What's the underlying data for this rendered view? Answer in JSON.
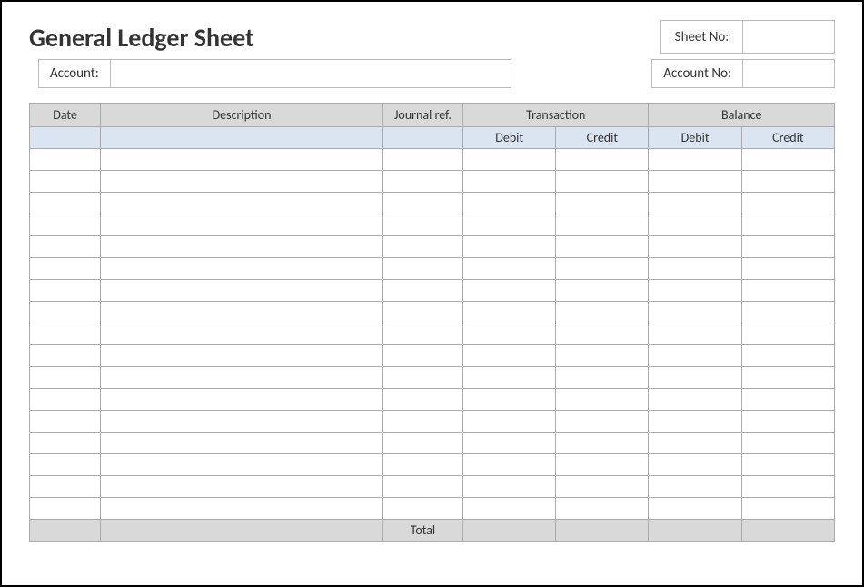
{
  "header": {
    "title": "General Ledger Sheet",
    "sheet_no_label": "Sheet No:",
    "sheet_no_value": "",
    "account_label": "Account:",
    "account_value": "",
    "account_no_label": "Account No:",
    "account_no_value": ""
  },
  "table": {
    "headers": {
      "date": "Date",
      "description": "Description",
      "journal_ref": "Journal ref.",
      "transaction": "Transaction",
      "balance": "Balance"
    },
    "subheaders": {
      "tx_debit": "Debit",
      "tx_credit": "Credit",
      "bal_debit": "Debit",
      "bal_credit": "Credit"
    },
    "rows": [
      {
        "date": "",
        "description": "",
        "journal_ref": "",
        "tx_debit": "",
        "tx_credit": "",
        "bal_debit": "",
        "bal_credit": ""
      },
      {
        "date": "",
        "description": "",
        "journal_ref": "",
        "tx_debit": "",
        "tx_credit": "",
        "bal_debit": "",
        "bal_credit": ""
      },
      {
        "date": "",
        "description": "",
        "journal_ref": "",
        "tx_debit": "",
        "tx_credit": "",
        "bal_debit": "",
        "bal_credit": ""
      },
      {
        "date": "",
        "description": "",
        "journal_ref": "",
        "tx_debit": "",
        "tx_credit": "",
        "bal_debit": "",
        "bal_credit": ""
      },
      {
        "date": "",
        "description": "",
        "journal_ref": "",
        "tx_debit": "",
        "tx_credit": "",
        "bal_debit": "",
        "bal_credit": ""
      },
      {
        "date": "",
        "description": "",
        "journal_ref": "",
        "tx_debit": "",
        "tx_credit": "",
        "bal_debit": "",
        "bal_credit": ""
      },
      {
        "date": "",
        "description": "",
        "journal_ref": "",
        "tx_debit": "",
        "tx_credit": "",
        "bal_debit": "",
        "bal_credit": ""
      },
      {
        "date": "",
        "description": "",
        "journal_ref": "",
        "tx_debit": "",
        "tx_credit": "",
        "bal_debit": "",
        "bal_credit": ""
      },
      {
        "date": "",
        "description": "",
        "journal_ref": "",
        "tx_debit": "",
        "tx_credit": "",
        "bal_debit": "",
        "bal_credit": ""
      },
      {
        "date": "",
        "description": "",
        "journal_ref": "",
        "tx_debit": "",
        "tx_credit": "",
        "bal_debit": "",
        "bal_credit": ""
      },
      {
        "date": "",
        "description": "",
        "journal_ref": "",
        "tx_debit": "",
        "tx_credit": "",
        "bal_debit": "",
        "bal_credit": ""
      },
      {
        "date": "",
        "description": "",
        "journal_ref": "",
        "tx_debit": "",
        "tx_credit": "",
        "bal_debit": "",
        "bal_credit": ""
      },
      {
        "date": "",
        "description": "",
        "journal_ref": "",
        "tx_debit": "",
        "tx_credit": "",
        "bal_debit": "",
        "bal_credit": ""
      },
      {
        "date": "",
        "description": "",
        "journal_ref": "",
        "tx_debit": "",
        "tx_credit": "",
        "bal_debit": "",
        "bal_credit": ""
      },
      {
        "date": "",
        "description": "",
        "journal_ref": "",
        "tx_debit": "",
        "tx_credit": "",
        "bal_debit": "",
        "bal_credit": ""
      },
      {
        "date": "",
        "description": "",
        "journal_ref": "",
        "tx_debit": "",
        "tx_credit": "",
        "bal_debit": "",
        "bal_credit": ""
      },
      {
        "date": "",
        "description": "",
        "journal_ref": "",
        "tx_debit": "",
        "tx_credit": "",
        "bal_debit": "",
        "bal_credit": ""
      }
    ],
    "total_label": "Total",
    "totals": {
      "tx_debit": "",
      "tx_credit": "",
      "bal_debit": "",
      "bal_credit": ""
    }
  }
}
